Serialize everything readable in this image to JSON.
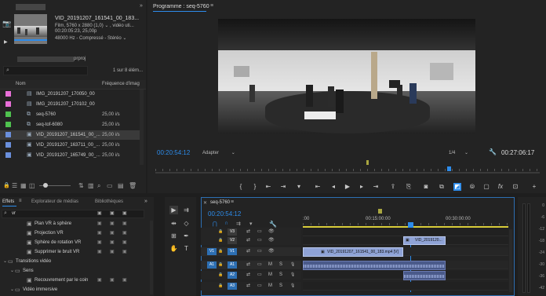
{
  "source": {
    "filename": "VID_20191207_161541_00_183...",
    "line1": "Film, 5760 x 2880 (1,0) ⌄ , vidéo uti...",
    "line2": "00:20:05:23, 25,00p",
    "line3": "48000 Hz - Compressé - Stéréo ⌄"
  },
  "project": {
    "name": "prproj",
    "item_count": "1 sur 8 élém...",
    "col_name": "Nom",
    "col_fps": "Fréquence d'imag",
    "items": [
      {
        "name": "IMG_20191207_170050_00",
        "fps": "",
        "color": "#e86fd8",
        "icon": "image-icon"
      },
      {
        "name": "IMG_20191207_170102_00",
        "fps": "",
        "color": "#e86fd8",
        "icon": "image-icon"
      },
      {
        "name": "seq-5760",
        "fps": "25,00 i/s",
        "color": "#4fc24f",
        "icon": "sequence-icon"
      },
      {
        "name": "seq-tof-6080",
        "fps": "25,00 i/s",
        "color": "#4fc24f",
        "icon": "sequence-icon"
      },
      {
        "name": "VID_20191207_161541_00_...",
        "fps": "25,00 i/s",
        "color": "#6a8fdc",
        "icon": "video-clip-icon"
      },
      {
        "name": "VID_20191207_163711_00_...",
        "fps": "25,00 i/s",
        "color": "#6a8fdc",
        "icon": "video-clip-icon"
      },
      {
        "name": "VID_20191207_165749_00_...",
        "fps": "25,00 i/s",
        "color": "#6a8fdc",
        "icon": "video-clip-icon"
      }
    ]
  },
  "program": {
    "title": "Programme : seq-5760",
    "timecode": "00:20:54:12",
    "fit": "Adapter",
    "quality": "1/4",
    "duration": "00:27:06:17"
  },
  "effects": {
    "tabs": [
      "Effets",
      "Explorateur de médias",
      "Bibliothèques"
    ],
    "search": "vr",
    "items": [
      {
        "label": "Plan VR à sphère",
        "indent": 2,
        "type": "effect"
      },
      {
        "label": "Projection VR",
        "indent": 2,
        "type": "effect"
      },
      {
        "label": "Sphère de rotation VR",
        "indent": 2,
        "type": "effect"
      },
      {
        "label": "Supprimer le bruit VR",
        "indent": 2,
        "type": "effect"
      },
      {
        "label": "Transitions vidéo",
        "indent": 0,
        "type": "folder"
      },
      {
        "label": "Sens",
        "indent": 1,
        "type": "folder"
      },
      {
        "label": "Recouvrement par le coin",
        "indent": 2,
        "type": "effect"
      },
      {
        "label": "Vidéo immersive",
        "indent": 1,
        "type": "folder"
      }
    ]
  },
  "timeline": {
    "title": "seq-5760",
    "timecode": "00:20:54:12",
    "ruler": [
      ":00",
      "00:15:00:00",
      "00:30:00:00"
    ],
    "tracks": [
      {
        "target": "",
        "name": "V3"
      },
      {
        "target": "",
        "name": "V2"
      },
      {
        "target": "V1",
        "name": "V1"
      },
      {
        "target": "A1",
        "name": "A1"
      },
      {
        "target": "",
        "name": "A2"
      },
      {
        "target": "",
        "name": "A3"
      }
    ],
    "clip_v1": "VID_20191207_161541_00_183.mp4 [V]",
    "clip_v2": "VID_2019120...",
    "track_m": "M",
    "track_s": "S"
  },
  "meter": {
    "labels": [
      "0",
      "-6",
      "-12",
      "-18",
      "-24",
      "-30",
      "-36",
      "-42"
    ]
  },
  "colors": {
    "accent": "#2d8ceb",
    "video_clip": "#8fa3d6",
    "audio_clip": "#5a6a9a",
    "playhead": "#2d8ceb"
  }
}
